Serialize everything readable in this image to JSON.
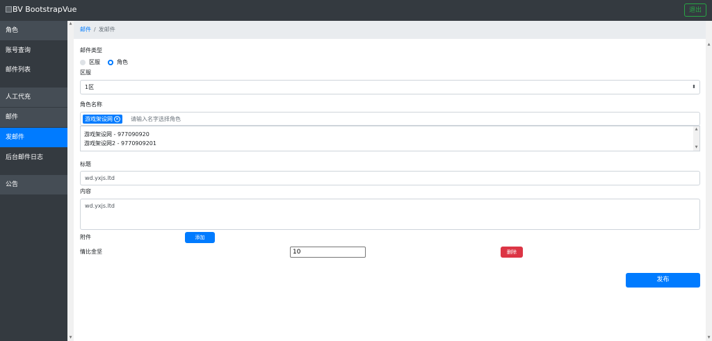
{
  "navbar": {
    "brand": "BV BootstrapVue",
    "logout_label": "退出"
  },
  "sidebar": {
    "items": [
      {
        "label": "角色"
      },
      {
        "label": "账号查询"
      },
      {
        "label": "邮件列表"
      },
      {
        "label": "人工代充"
      },
      {
        "label": "邮件"
      },
      {
        "label": "发邮件"
      },
      {
        "label": "后台邮件日志"
      },
      {
        "label": "公告"
      }
    ]
  },
  "breadcrumb": {
    "parent": "邮件",
    "separator": "/",
    "current": "发邮件"
  },
  "form": {
    "mail_type_label": "邮件类型",
    "mail_type_options": [
      {
        "label": "区服",
        "checked": false
      },
      {
        "label": "角色",
        "checked": true
      }
    ],
    "server_label": "区服",
    "server_selected": "1区",
    "role_label": "角色名称",
    "role_tag": "游戏架设网",
    "role_placeholder": "请输入名字选择角色",
    "role_options": [
      "游戏架设网 - 977090920",
      "游戏架设网2 - 9770909201"
    ],
    "title_label": "标题",
    "title_value": "wd.yxjs.ltd",
    "content_label": "内容",
    "content_value": "wd.yxjs.ltd",
    "attachment_label": "附件",
    "add_label": "添加",
    "attachment_item": {
      "name": "情比金坚",
      "quantity": "10",
      "delete_label": "删除"
    },
    "publish_label": "发布"
  },
  "colors": {
    "navbar": "#343a40",
    "primary": "#007bff",
    "danger": "#dc3545",
    "success": "#28a745"
  }
}
